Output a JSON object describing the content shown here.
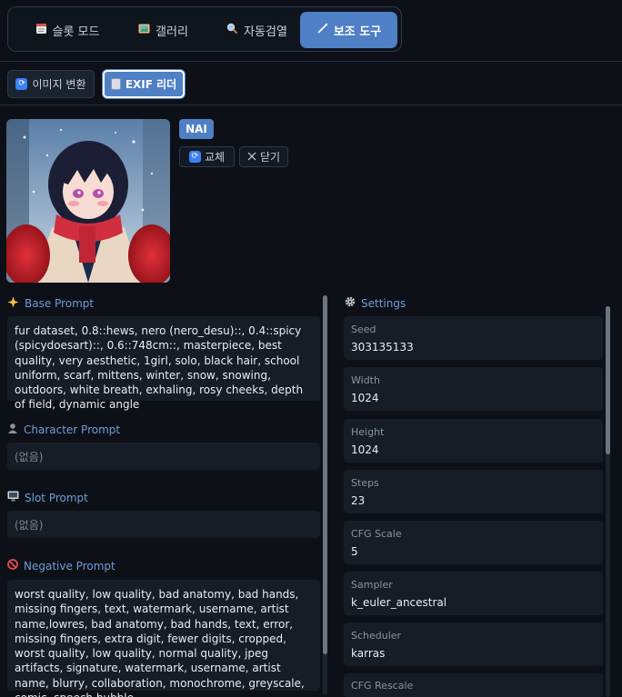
{
  "tabs": [
    {
      "icon": "memo-icon",
      "label": "슬롯 모드"
    },
    {
      "icon": "picture-icon",
      "label": "갤러리"
    },
    {
      "icon": "magnifier-icon",
      "label": "자동검열"
    },
    {
      "icon": "wand-icon",
      "label": "보조 도구",
      "active": true
    }
  ],
  "subtabs": [
    {
      "label": "이미지 변환"
    },
    {
      "label": "EXIF 리더",
      "active": true
    }
  ],
  "image": {
    "badge": "NAI",
    "replace_label": "교체",
    "close_label": "닫기"
  },
  "prompts": {
    "base": {
      "title": "Base Prompt",
      "text": "fur dataset, 0.8::hews, nero (nero_desu)::, 0.4::spicy (spicydoesart)::, 0.6::748cm::, masterpiece, best quality, very aesthetic, 1girl, solo, black hair, school uniform, scarf, mittens, winter, snow, snowing, outdoors, white breath, exhaling, rosy cheeks, depth of field, dynamic angle"
    },
    "character": {
      "title": "Character Prompt",
      "text": "(없음)"
    },
    "slot": {
      "title": "Slot Prompt",
      "text": "(없음)"
    },
    "negative": {
      "title": "Negative Prompt",
      "text": "worst quality, low quality, bad anatomy, bad hands, missing fingers, text, watermark, username, artist name,lowres, bad anatomy, bad hands, text, error, missing fingers, extra digit, fewer digits, cropped, worst quality, low quality, normal quality, jpeg artifacts, signature, watermark, username, artist name, blurry, collaboration, monochrome, greyscale, comic, speech bubble"
    }
  },
  "settings": {
    "title": "Settings",
    "items": [
      {
        "label": "Seed",
        "value": "303135133"
      },
      {
        "label": "Width",
        "value": "1024"
      },
      {
        "label": "Height",
        "value": "1024"
      },
      {
        "label": "Steps",
        "value": "23"
      },
      {
        "label": "CFG Scale",
        "value": "5"
      },
      {
        "label": "Sampler",
        "value": "k_euler_ancestral"
      },
      {
        "label": "Scheduler",
        "value": "karras"
      },
      {
        "label": "CFG Rescale",
        "value": ""
      }
    ]
  },
  "colors": {
    "background": "#0d1117",
    "accent": "#4f7fc4",
    "section_title": "#6f9bd8",
    "card": "#161d27"
  }
}
